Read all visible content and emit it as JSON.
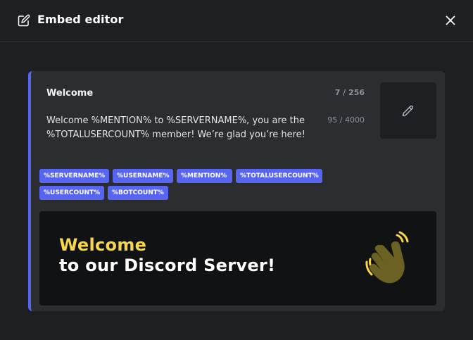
{
  "header": {
    "title": "Embed editor",
    "icon": "edit-icon",
    "close_icon": "close-icon"
  },
  "embed": {
    "accent_color": "#5865f2",
    "title": "Welcome",
    "title_count": "7 / 256",
    "description": "Welcome %MENTION% to %SERVERNAME%, you are the %TOTALUSERCOUNT% member! We’re glad you’re here!",
    "description_count": "95 / 4000",
    "thumbnail_icon": "pencil-icon"
  },
  "tags": [
    "%SERVERNAME%",
    "%USERNAME%",
    "%MENTION%",
    "%TOTALUSERCOUNT%",
    "%USERCOUNT%",
    "%BOTCOUNT%"
  ],
  "banner": {
    "line1": "Welcome",
    "line2": "to our Discord Server!",
    "line1_color": "#f8d648",
    "icon": "waving-hand-icon"
  }
}
